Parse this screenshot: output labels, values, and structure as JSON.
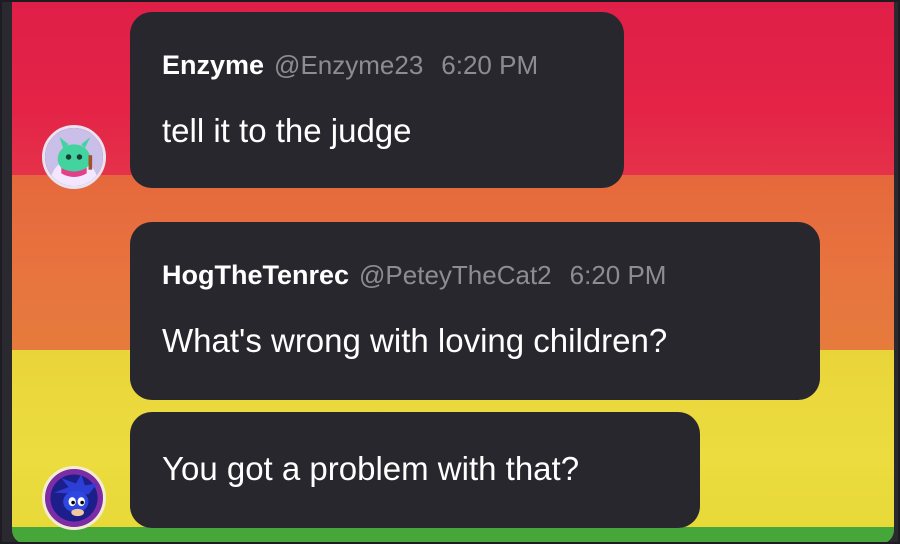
{
  "messages": [
    {
      "author": "Enzyme",
      "handle": "@Enzyme23",
      "time": "6:20 PM",
      "text": "tell it to the judge",
      "avatar_icon": "green-creature-avatar-icon"
    },
    {
      "author": "HogTheTenrec",
      "handle": "@PeteyTheCat2",
      "time": "6:20 PM",
      "text": "What's wrong with loving children?",
      "avatar_icon": "blue-hedgehog-avatar-icon"
    },
    {
      "text": "You got a problem with that?"
    }
  ],
  "colors": {
    "bubble": "#28272e",
    "stripe_red": "#e22347",
    "stripe_orange": "#e8733f",
    "stripe_yellow": "#ecdc3f",
    "stripe_green": "#47a63a",
    "muted_text": "#8d8c93"
  }
}
